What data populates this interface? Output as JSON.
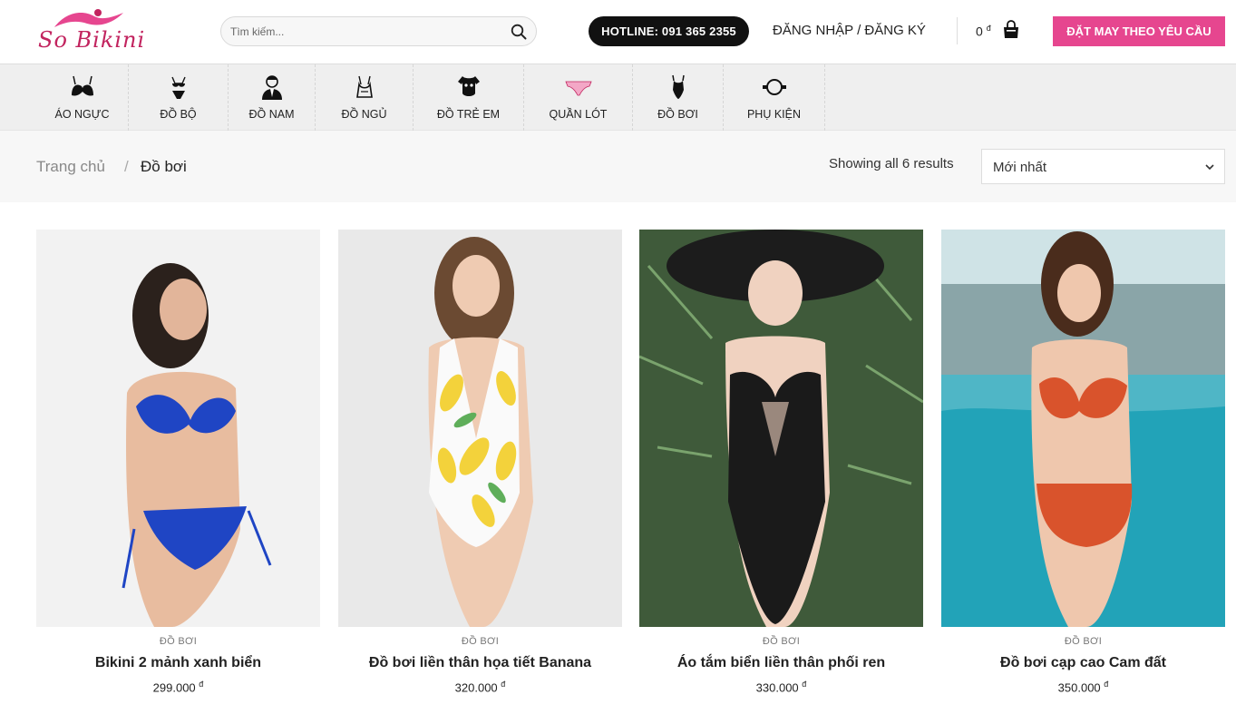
{
  "header": {
    "logo_text": "So Bikini",
    "search_placeholder": "Tìm kiếm...",
    "hotline": "HOTLINE: 091 365 2355",
    "login": "ĐĂNG NHẬP / ĐĂNG KÝ",
    "cart_amount": "0",
    "currency": "đ",
    "custom_order": "ĐẶT MAY THEO YÊU CẦU"
  },
  "categories": [
    {
      "label": "ÁO NGỰC",
      "icon": "bra-icon"
    },
    {
      "label": "ĐỒ BỘ",
      "icon": "lingerie-set-icon"
    },
    {
      "label": "ĐỒ NAM",
      "icon": "man-icon"
    },
    {
      "label": "ĐỒ NGỦ",
      "icon": "nightwear-icon"
    },
    {
      "label": "ĐỒ TRẺ EM",
      "icon": "kids-bodysuit-icon"
    },
    {
      "label": "QUẦN LÓT",
      "icon": "panties-icon"
    },
    {
      "label": "ĐỒ BƠI",
      "icon": "swimsuit-icon"
    },
    {
      "label": "PHỤ KIỆN",
      "icon": "accessory-icon"
    }
  ],
  "breadcrumb": {
    "home": "Trang chủ",
    "separator": "/",
    "current": "Đồ bơi"
  },
  "results": {
    "count_text": "Showing all 6 results",
    "sort_value": "Mới nhất"
  },
  "products": [
    {
      "category": "ĐỒ BƠI",
      "name": "Bikini 2 mảnh xanh biển",
      "price": "299.000",
      "swim_color": "#1f45c4",
      "bg": "#f2f2f2"
    },
    {
      "category": "ĐỒ BƠI",
      "name": "Đồ bơi liền thân họa tiết Banana",
      "price": "320.000",
      "swim_color": "#f3d23b",
      "bg": "#e9e9e9"
    },
    {
      "category": "ĐỒ BƠI",
      "name": "Áo tắm biển liền thân phối ren",
      "price": "330.000",
      "swim_color": "#1a1a1a",
      "bg": "#3f5a3a"
    },
    {
      "category": "ĐỒ BƠI",
      "name": "Đồ bơi cạp cao Cam đất",
      "price": "350.000",
      "swim_color": "#d9532c",
      "bg": "#4fb6c6"
    }
  ],
  "colors": {
    "brand_pink": "#e6468f",
    "logo": "#c2245f",
    "hotline_bg": "#111111"
  }
}
